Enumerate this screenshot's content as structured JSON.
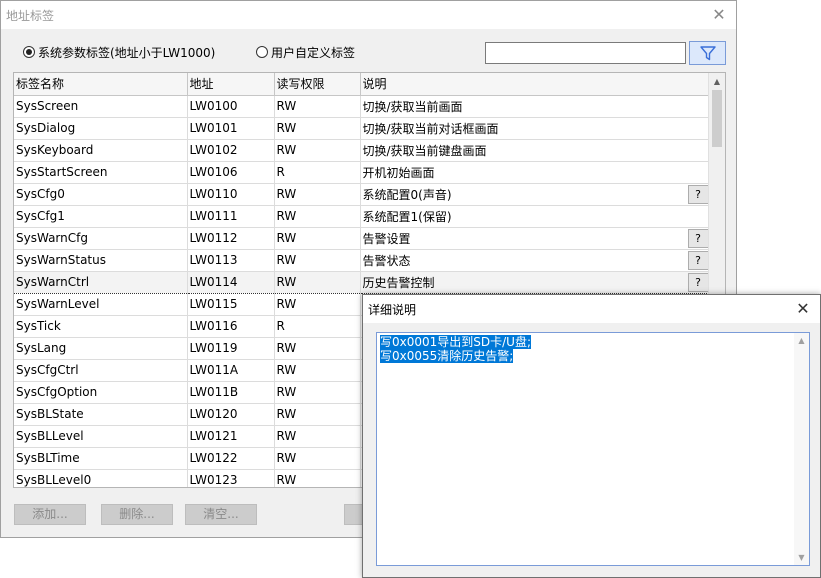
{
  "window": {
    "title": "地址标签",
    "close_glyph": "✕"
  },
  "options": {
    "system_radio_label": "系统参数标签(地址小于LW1000)",
    "system_radio_checked": true,
    "custom_radio_label": "用户自定义标签",
    "custom_radio_checked": false
  },
  "search": {
    "value": "",
    "placeholder": ""
  },
  "table": {
    "columns": [
      "标签名称",
      "地址",
      "读写权限",
      "说明"
    ],
    "rows": [
      {
        "name": "SysScreen",
        "address": "LW0100",
        "access": "RW",
        "desc": "切换/获取当前画面",
        "help": false
      },
      {
        "name": "SysDialog",
        "address": "LW0101",
        "access": "RW",
        "desc": "切换/获取当前对话框画面",
        "help": false
      },
      {
        "name": "SysKeyboard",
        "address": "LW0102",
        "access": "RW",
        "desc": "切换/获取当前键盘画面",
        "help": false
      },
      {
        "name": "SysStartScreen",
        "address": "LW0106",
        "access": "R",
        "desc": "开机初始画面",
        "help": false
      },
      {
        "name": "SysCfg0",
        "address": "LW0110",
        "access": "RW",
        "desc": "系统配置0(声音)",
        "help": true
      },
      {
        "name": "SysCfg1",
        "address": "LW0111",
        "access": "RW",
        "desc": "系统配置1(保留)",
        "help": false
      },
      {
        "name": "SysWarnCfg",
        "address": "LW0112",
        "access": "RW",
        "desc": "告警设置",
        "help": true
      },
      {
        "name": "SysWarnStatus",
        "address": "LW0113",
        "access": "RW",
        "desc": "告警状态",
        "help": true
      },
      {
        "name": "SysWarnCtrl",
        "address": "LW0114",
        "access": "RW",
        "desc": "历史告警控制",
        "help": true,
        "selected": true
      },
      {
        "name": "SysWarnLevel",
        "address": "LW0115",
        "access": "RW",
        "desc": "",
        "help": false
      },
      {
        "name": "SysTick",
        "address": "LW0116",
        "access": "R",
        "desc": "",
        "help": false
      },
      {
        "name": "SysLang",
        "address": "LW0119",
        "access": "RW",
        "desc": "",
        "help": false
      },
      {
        "name": "SysCfgCtrl",
        "address": "LW011A",
        "access": "RW",
        "desc": "",
        "help": false
      },
      {
        "name": "SysCfgOption",
        "address": "LW011B",
        "access": "RW",
        "desc": "",
        "help": false
      },
      {
        "name": "SysBLState",
        "address": "LW0120",
        "access": "RW",
        "desc": "",
        "help": false
      },
      {
        "name": "SysBLLevel",
        "address": "LW0121",
        "access": "RW",
        "desc": "",
        "help": false
      },
      {
        "name": "SysBLTime",
        "address": "LW0122",
        "access": "RW",
        "desc": "",
        "help": false
      },
      {
        "name": "SysBLLevel0",
        "address": "LW0123",
        "access": "RW",
        "desc": "",
        "help": false
      }
    ],
    "help_label": "?"
  },
  "buttons": {
    "add": "添加...",
    "delete": "删除...",
    "clear": "清空..."
  },
  "detail": {
    "title": "详细说明",
    "lines": [
      "写0x0001导出到SD卡/U盘;",
      "写0x0055清除历史告警;"
    ]
  },
  "colors": {
    "selection": "#0078d7",
    "filter_button_bg": "#dce8fb",
    "filter_icon": "#3a6fd8"
  },
  "icons": {
    "filter": "funnel-icon",
    "scroll_up": "▲",
    "scroll_down": "▼"
  }
}
